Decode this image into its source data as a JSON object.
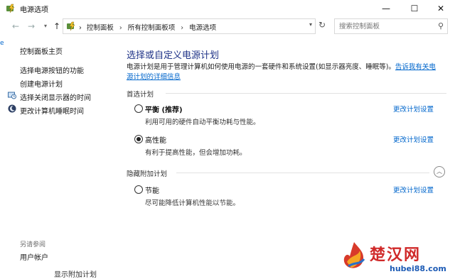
{
  "window": {
    "title": "电源选项"
  },
  "window_controls": {
    "minimize": "—",
    "maximize": "☐",
    "close": "✕"
  },
  "nav": {
    "back": "←",
    "forward": "→",
    "history": "▾",
    "up": "↑",
    "breadcrumbs": [
      "控制面板",
      "所有控制面板项",
      "电源选项"
    ],
    "separator": "›",
    "dropdown": "▾",
    "refresh": "↻",
    "search_placeholder": "搜索控制面板",
    "search_icon": "⚲"
  },
  "sidebar": {
    "home": "控制面板主页",
    "links": [
      "选择电源按钮的功能",
      "创建电源计划",
      "选择关闭显示器的时间",
      "更改计算机睡眠时间"
    ],
    "see_also_label": "另请参阅",
    "see_also_links": [
      "用户帐户"
    ]
  },
  "left_edge_char": "e",
  "main": {
    "title": "选择或自定义电源计划",
    "intro_text": "电源计划是用于管理计算机如何使用电源的一套硬件和系统设置(如显示器亮度、睡眠等)。",
    "intro_link": "告诉我有关电源计划的详细信息",
    "preferred_label": "首选计划",
    "hidden_label": "隐藏附加计划",
    "collapse_icon": "︿",
    "change_label": "更改计划设置",
    "plans": [
      {
        "name": "平衡 (推荐)",
        "desc": "利用可用的硬件自动平衡功耗与性能。",
        "selected": false
      },
      {
        "name": "高性能",
        "desc": "有利于提高性能，但会增加功耗。",
        "selected": true
      },
      {
        "name": "节能",
        "desc": "尽可能降低计算机性能以节能。",
        "selected": false
      }
    ]
  },
  "footer_partial": "显示附加计划",
  "watermark": {
    "main": "楚汉网",
    "url": "hubei88.com"
  }
}
